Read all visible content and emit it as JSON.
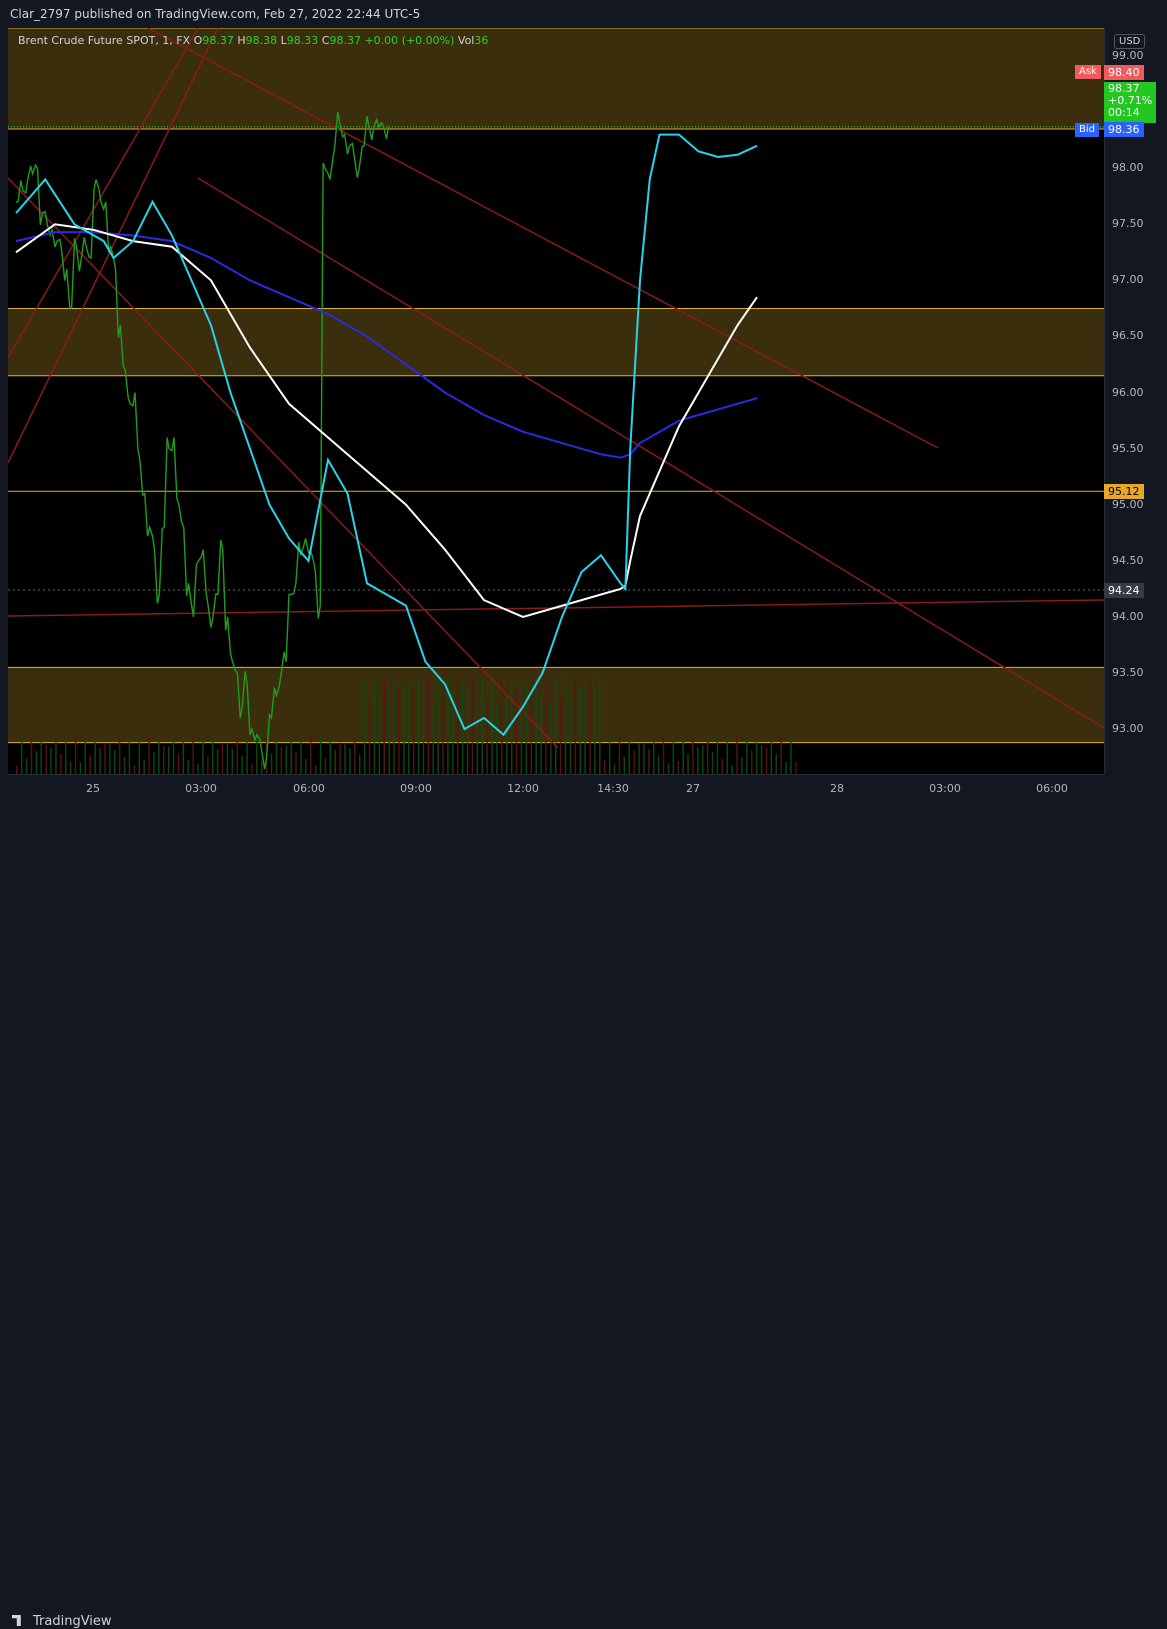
{
  "header": {
    "publisher": "Clar_2797 published on TradingView.com, Feb 27, 2022 22:44 UTC-5"
  },
  "legend": {
    "symbol": "Brent Crude Future SPOT, 1, FX",
    "open_label": "O",
    "open": "98.37",
    "high_label": "H",
    "high": "98.38",
    "low_label": "L",
    "low": "98.33",
    "close_label": "C",
    "close": "98.37",
    "change": "+0.00 (+0.00%)",
    "vol_label": "Vol",
    "vol": "36"
  },
  "price_axis": {
    "currency": "USD",
    "ticks": [
      "99.00",
      "98.50",
      "98.00",
      "97.50",
      "97.00",
      "96.50",
      "96.00",
      "95.50",
      "95.00",
      "94.50",
      "94.00",
      "93.50",
      "93.00"
    ],
    "ask_label": "Ask",
    "ask": "98.40",
    "bid_label": "Bid",
    "bid": "98.36",
    "last_price": "98.37",
    "last_change": "+0.71%",
    "countdown": "00:14",
    "level_1": "95.12",
    "level_2": "94.24"
  },
  "time_axis": {
    "ticks": [
      "25",
      "03:00",
      "06:00",
      "09:00",
      "12:00",
      "14:30",
      "27",
      "28",
      "03:00",
      "06:00"
    ]
  },
  "footer": {
    "brand": "TradingView"
  },
  "colors": {
    "background": "#000000",
    "zone_fill": "#3a2e0c",
    "zone_line": "#d9b33a",
    "trend_line": "#8b1a1a",
    "ema_fast": "#29d3e8",
    "ema_mid": "#ffffff",
    "ema_slow": "#2a2be0",
    "ask": "#f05a5a",
    "bid": "#2962ff",
    "last": "#22c722",
    "level_1": "#e6a829",
    "level_2": "#363a45"
  },
  "chart_data": {
    "type": "line",
    "ylim": [
      92.6,
      99.25
    ],
    "zones": [
      [
        98.35,
        99.25
      ],
      [
        96.15,
        96.75
      ],
      [
        92.88,
        93.55
      ]
    ],
    "levels": [
      95.12,
      94.24,
      98.37
    ],
    "price": {
      "x": [
        0,
        0.5,
        1,
        1.5,
        2,
        2.5,
        3,
        3.5,
        4,
        4.5,
        5,
        5.5,
        6,
        6.5,
        7,
        7.5,
        8,
        8.5,
        9,
        9.5,
        10,
        10.5,
        11,
        11.5,
        12,
        12.5,
        13,
        13.5,
        14,
        14.5,
        15,
        15.5,
        16,
        16.5,
        17,
        17.5,
        18,
        18.5,
        19,
        19.5,
        20,
        20.5,
        21,
        21.5,
        22,
        22.5,
        23,
        23.5,
        24,
        24.5,
        25,
        25.5,
        26,
        26.5,
        27,
        27.5,
        28,
        28.5,
        29,
        29.5,
        30,
        30.5,
        31,
        31.5,
        32,
        32.5,
        33,
        33.5,
        34,
        34.5,
        35,
        35.5,
        36,
        36.5,
        37,
        37.5,
        38,
        38.5,
        39,
        39.5,
        40,
        40.5,
        41,
        41.5,
        42,
        42.5,
        43,
        43.5,
        44,
        44.5,
        45,
        45.5,
        46,
        46.5,
        47,
        47.5,
        48,
        48.5,
        49,
        49.5,
        50,
        50.5,
        51,
        51.5,
        52,
        52.5,
        53,
        53.5,
        54,
        54.5,
        55,
        55.5,
        56,
        56.5,
        57,
        57.5,
        58,
        58.5,
        59,
        59.5,
        60,
        60.5,
        61,
        61.5,
        62,
        62.5,
        63,
        63.5,
        64,
        64.5,
        65,
        65.5,
        66,
        66.5,
        67,
        67.5,
        68,
        68.5,
        69,
        69.5,
        70,
        70.5,
        71,
        71.5,
        72,
        72.5,
        73,
        73.5,
        74,
        74.5,
        75,
        75.5,
        76,
        76.5,
        77,
        77.5,
        78,
        78.5,
        79,
        79.5,
        80
      ],
      "y": [
        97.7,
        97.8,
        97.9,
        97.95,
        98.0,
        97.6,
        97.5,
        97.45,
        97.35,
        97.25,
        97.1,
        96.75,
        97.3,
        97.2,
        97.3,
        97.2,
        97.9,
        97.7,
        97.7,
        97.3,
        97.1,
        96.6,
        96.2,
        95.9,
        96.0,
        95.4,
        95.1,
        94.8,
        94.6,
        94.2,
        94.8,
        95.5,
        95.6,
        95.0,
        94.8,
        94.3,
        94.0,
        94.5,
        94.6,
        94.1,
        94.0,
        94.2,
        94.6,
        94.0,
        93.6,
        93.5,
        93.2,
        93.4,
        93.0,
        92.95,
        92.8,
        92.75,
        93.1,
        93.3,
        93.5,
        93.6,
        94.2,
        94.3,
        94.55,
        94.7,
        94.6,
        94.4,
        94.1,
        98.0,
        97.9,
        98.2,
        98.4,
        98.3,
        98.2,
        98.1,
        98.0,
        98.2,
        98.37,
        98.37,
        98.37,
        98.37,
        98.37,
        98.37,
        98.37,
        98.37,
        98.37
      ],
      "extent": 76
    },
    "ema_fast": {
      "x": [
        0,
        3,
        6,
        9,
        10,
        12,
        14,
        16,
        20,
        22,
        24,
        26,
        28,
        30,
        32,
        34,
        36,
        38,
        40,
        42,
        44,
        46,
        48,
        50,
        52,
        54,
        56,
        58,
        60,
        62,
        62.5,
        63,
        64,
        65,
        66,
        68,
        70,
        72,
        74,
        76
      ],
      "y": [
        97.6,
        97.9,
        97.5,
        97.35,
        97.2,
        97.35,
        97.7,
        97.4,
        96.6,
        96.0,
        95.5,
        95.0,
        94.7,
        94.5,
        95.4,
        95.1,
        94.3,
        94.2,
        94.1,
        93.6,
        93.4,
        93.0,
        93.1,
        92.95,
        93.2,
        93.5,
        94.0,
        94.4,
        94.55,
        94.3,
        94.25,
        95.5,
        97.0,
        97.9,
        98.3,
        98.3,
        98.15,
        98.1,
        98.12,
        98.2
      ]
    },
    "ema_mid": {
      "x": [
        0,
        4,
        8,
        12,
        16,
        20,
        24,
        28,
        32,
        36,
        40,
        44,
        48,
        52,
        56,
        60,
        62,
        62.5,
        63,
        64,
        66,
        68,
        70,
        72,
        74,
        76
      ],
      "y": [
        97.25,
        97.5,
        97.45,
        97.35,
        97.3,
        97.0,
        96.4,
        95.9,
        95.6,
        95.3,
        95.0,
        94.6,
        94.15,
        94.0,
        94.1,
        94.2,
        94.25,
        94.28,
        94.5,
        94.9,
        95.3,
        95.7,
        96.0,
        96.3,
        96.6,
        96.85
      ]
    },
    "ema_slow": {
      "x": [
        0,
        4,
        8,
        12,
        16,
        20,
        24,
        28,
        32,
        36,
        40,
        44,
        48,
        52,
        56,
        60,
        62,
        63,
        64,
        66,
        68,
        70,
        72,
        74,
        76
      ],
      "y": [
        97.35,
        97.43,
        97.43,
        97.4,
        97.35,
        97.2,
        97.0,
        96.85,
        96.7,
        96.5,
        96.25,
        96.0,
        95.8,
        95.65,
        95.55,
        95.45,
        95.42,
        95.45,
        95.55,
        95.65,
        95.75,
        95.8,
        95.85,
        95.9,
        95.95
      ]
    }
  }
}
